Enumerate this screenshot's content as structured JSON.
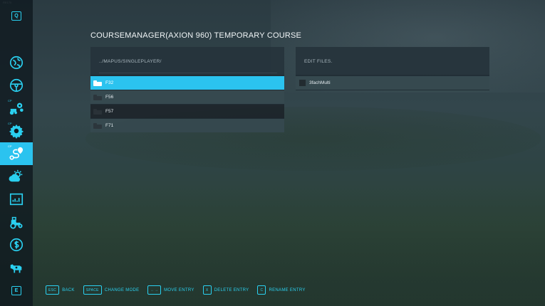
{
  "version": "RE170",
  "sidebar": {
    "top_key": "Q",
    "bottom_key": "E",
    "items": [
      {
        "icon": "world-map-icon",
        "badge": ""
      },
      {
        "icon": "steering-wheel-icon",
        "badge": ""
      },
      {
        "icon": "tractor-gears-icon",
        "badge": "CP"
      },
      {
        "icon": "gear-icon",
        "badge": "CP"
      },
      {
        "icon": "route-pin-icon",
        "badge": "CP",
        "active": true
      },
      {
        "icon": "weather-icon",
        "badge": ""
      },
      {
        "icon": "statistics-icon",
        "badge": ""
      },
      {
        "icon": "tractor-icon",
        "badge": ""
      },
      {
        "icon": "finance-dollar-icon",
        "badge": ""
      },
      {
        "icon": "cow-icon",
        "badge": ""
      }
    ]
  },
  "title": "COURSEMANAGER(AXION 960) TEMPORARY COURSE",
  "left_panel": {
    "path": "../MAPUS/SINGLEPLAYER/",
    "rows": [
      {
        "label": "F32",
        "selected": true
      },
      {
        "label": "F56",
        "selected": false
      },
      {
        "label": "F57",
        "selected": false
      },
      {
        "label": "F71",
        "selected": false
      }
    ]
  },
  "right_panel": {
    "header": "EDIT FILES.",
    "rows": [
      {
        "label": "3fachMulti"
      }
    ]
  },
  "footer": [
    {
      "key": "ESC",
      "label": "BACK"
    },
    {
      "key": "SPACE",
      "label": "CHANGE MODE"
    },
    {
      "key": "←→",
      "label": "MOVE ENTRY"
    },
    {
      "key": "X",
      "label": "DELETE ENTRY"
    },
    {
      "key": "C",
      "label": "RENAME ENTRY"
    }
  ],
  "colors": {
    "accent": "#2bc3ef",
    "sidebar_bg": "#101a20"
  }
}
